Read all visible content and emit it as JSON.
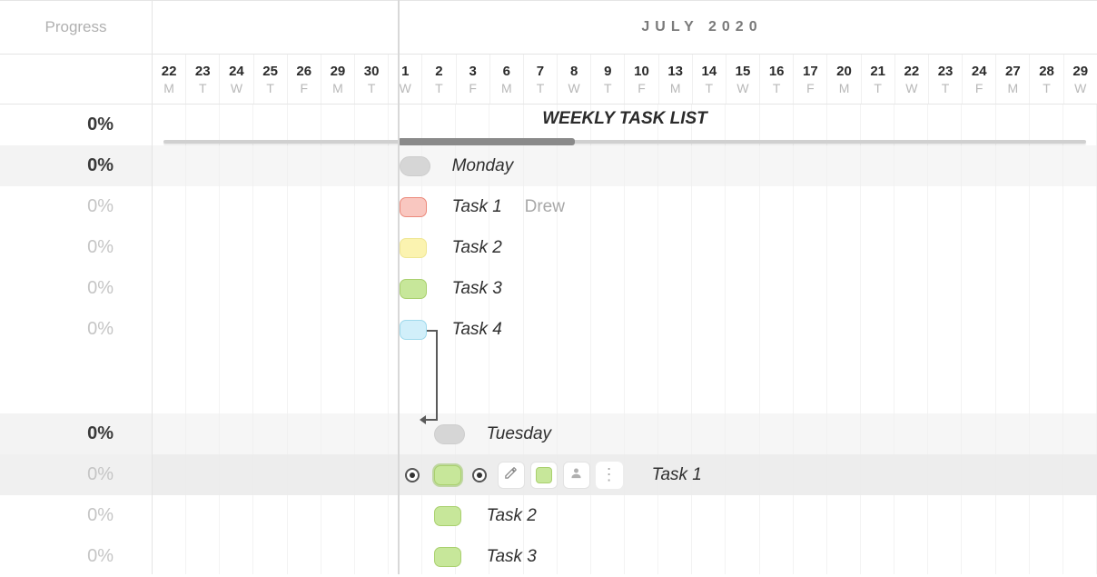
{
  "header": {
    "progress_label": "Progress",
    "month_label": "JULY 2020",
    "title": "WEEKLY TASK LIST"
  },
  "dates": [
    {
      "num": "22",
      "dow": "M"
    },
    {
      "num": "23",
      "dow": "T"
    },
    {
      "num": "24",
      "dow": "W"
    },
    {
      "num": "25",
      "dow": "T"
    },
    {
      "num": "26",
      "dow": "F"
    },
    {
      "num": "29",
      "dow": "M"
    },
    {
      "num": "30",
      "dow": "T"
    },
    {
      "num": "1",
      "dow": "W"
    },
    {
      "num": "2",
      "dow": "T"
    },
    {
      "num": "3",
      "dow": "F"
    },
    {
      "num": "6",
      "dow": "M"
    },
    {
      "num": "7",
      "dow": "T"
    },
    {
      "num": "8",
      "dow": "W"
    },
    {
      "num": "9",
      "dow": "T"
    },
    {
      "num": "10",
      "dow": "F"
    },
    {
      "num": "13",
      "dow": "M"
    },
    {
      "num": "14",
      "dow": "T"
    },
    {
      "num": "15",
      "dow": "W"
    },
    {
      "num": "16",
      "dow": "T"
    },
    {
      "num": "17",
      "dow": "F"
    },
    {
      "num": "20",
      "dow": "M"
    },
    {
      "num": "21",
      "dow": "T"
    },
    {
      "num": "22",
      "dow": "W"
    },
    {
      "num": "23",
      "dow": "T"
    },
    {
      "num": "24",
      "dow": "F"
    },
    {
      "num": "27",
      "dow": "M"
    },
    {
      "num": "28",
      "dow": "T"
    },
    {
      "num": "29",
      "dow": "W"
    }
  ],
  "progress": {
    "title": "0%",
    "monday": "0%",
    "t1": "0%",
    "t2": "0%",
    "t3": "0%",
    "t4": "0%",
    "tuesday": "0%",
    "tu1": "0%",
    "tu2": "0%",
    "tu3": "0%"
  },
  "tasks": {
    "monday_label": "Monday",
    "monday": [
      {
        "label": "Task 1",
        "assignee": "Drew",
        "color": "red"
      },
      {
        "label": "Task 2",
        "color": "yellow"
      },
      {
        "label": "Task 3",
        "color": "green"
      },
      {
        "label": "Task 4",
        "color": "blue"
      }
    ],
    "tuesday_label": "Tuesday",
    "tuesday": [
      {
        "label": "Task 1",
        "color": "green"
      },
      {
        "label": "Task 2",
        "color": "green"
      },
      {
        "label": "Task 3",
        "color": "green"
      }
    ]
  },
  "toolbar": {
    "edit": "✎",
    "person": "◉",
    "menu": "⋮"
  }
}
